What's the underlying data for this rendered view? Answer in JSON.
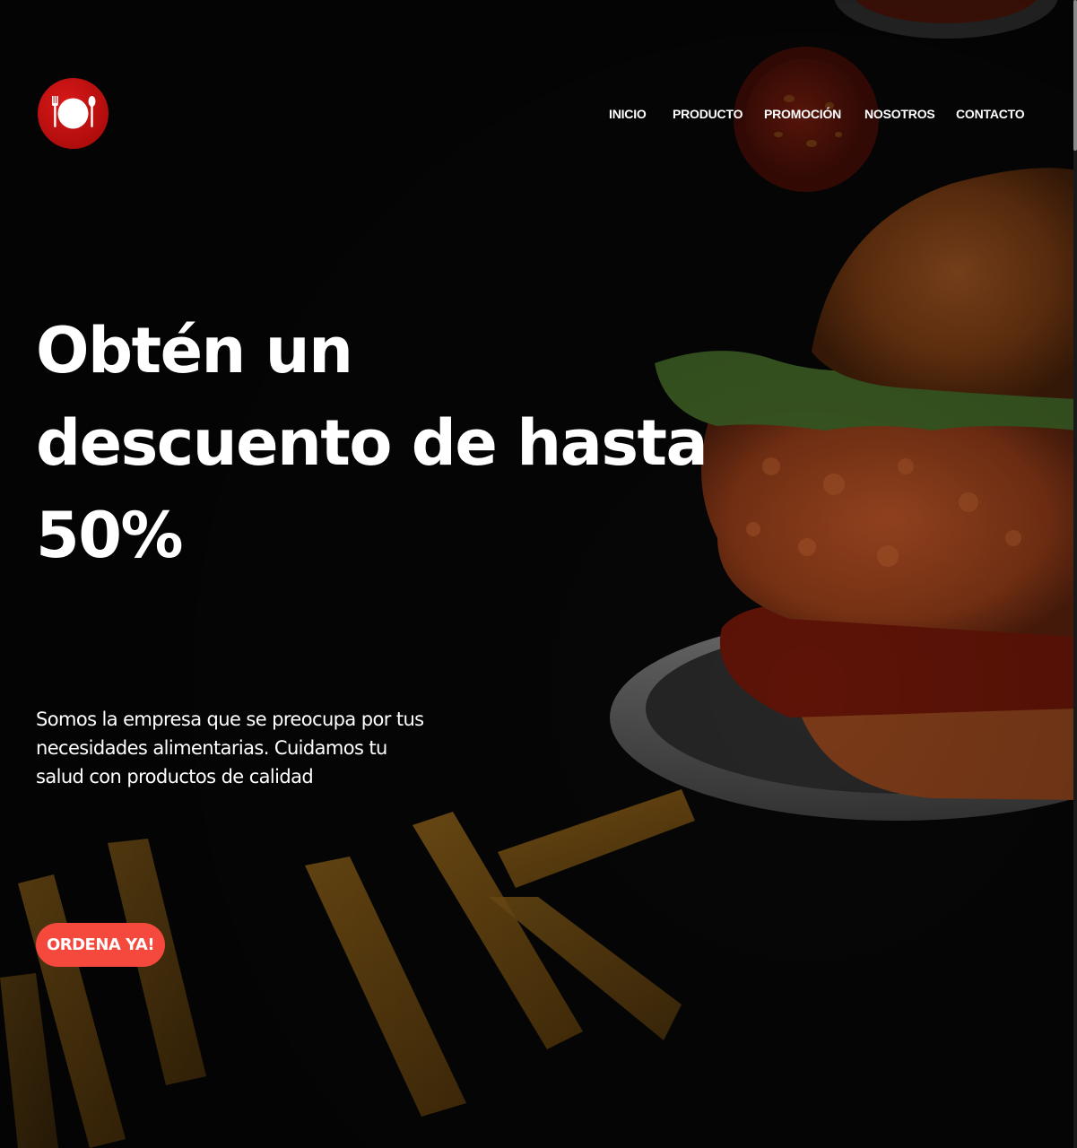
{
  "brand": {
    "logo_icon": "plate-cutlery-icon",
    "logo_color": "#c00f10"
  },
  "nav": {
    "items": [
      {
        "label": "INICIO"
      },
      {
        "label": "PRODUCTO"
      },
      {
        "label": "PROMOCIÓN"
      },
      {
        "label": "NOSOTROS"
      },
      {
        "label": "CONTACTO"
      }
    ]
  },
  "hero": {
    "headline_lines": [
      "Obtén un",
      "descuento de hasta",
      "50%"
    ],
    "description_lines": [
      "Somos la empresa que se preocupa por tus",
      "necesidades alimentarias. Cuidamos tu",
      "salud con productos de calidad"
    ],
    "cta_label": "ORDENA YA!",
    "background_image": "burger-and-fries-photo",
    "background_color": "#060606"
  },
  "colors": {
    "accent": "#f4493c",
    "text": "#ffffff"
  }
}
